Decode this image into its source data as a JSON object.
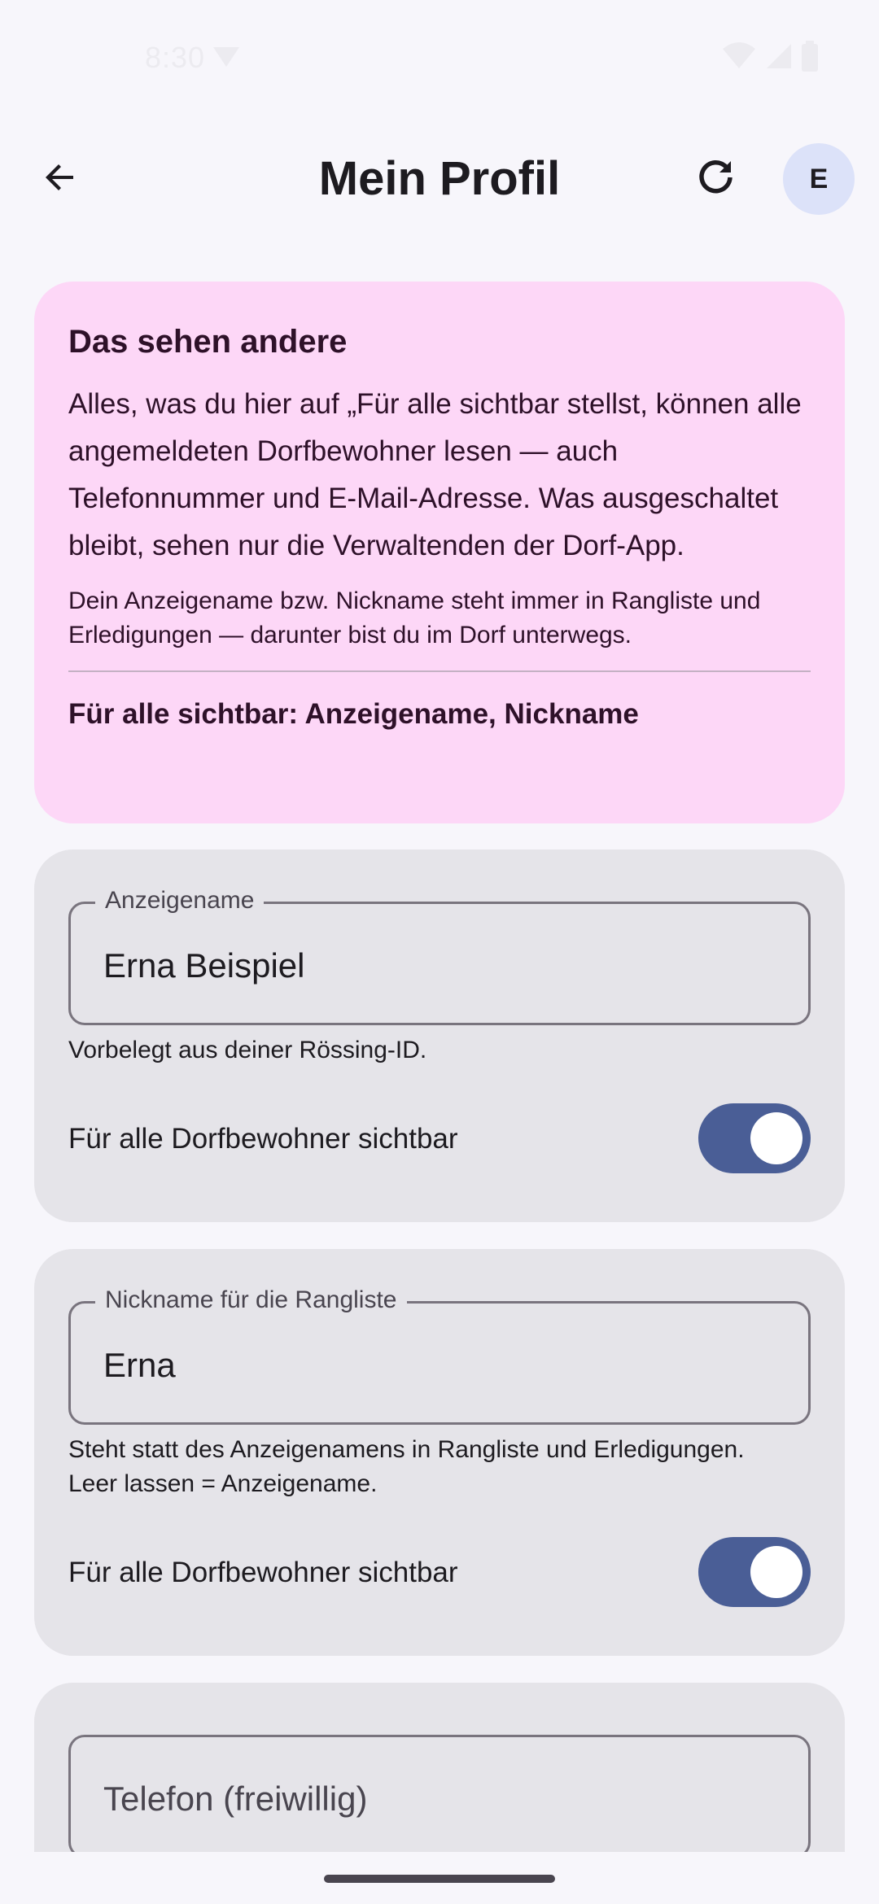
{
  "status_bar": {
    "time": "8:30"
  },
  "header": {
    "title": "Mein Profil",
    "back_icon": "arrow-back-icon",
    "refresh_icon": "refresh-icon",
    "avatar_initial": "E"
  },
  "info_card": {
    "title": "Das sehen andere",
    "body": "Alles, was du hier auf „Für alle sichtbar stellst, können alle angemeldeten Dorfbewohner lesen — auch Telefonnummer und E-Mail-Adresse. Was ausgeschaltet bleibt, sehen nur die Verwaltenden der Dorf-App.",
    "note": "Dein Anzeigename bzw. Nickname steht immer in Rangliste und Erledigungen — darunter bist du im Dorf unterwegs.",
    "summary": "Für alle sichtbar: Anzeigename, Nickname",
    "background": "#fdd7f7"
  },
  "display_name_card": {
    "label": "Anzeigename",
    "value": "Erna Beispiel",
    "helper": "Vorbelegt aus deiner Rössing-ID.",
    "toggle_label": "Für alle Dorfbewohner sichtbar",
    "toggle_on": true
  },
  "nickname_card": {
    "label": "Nickname für die Rangliste",
    "value": "Erna",
    "helper_line1": "Steht statt des Anzeigenamens in Rangliste und Erledigungen.",
    "helper_line2": "Leer lassen = Anzeigename.",
    "toggle_label": "Für alle Dorfbewohner sichtbar",
    "toggle_on": true
  },
  "phone_card": {
    "placeholder": "Telefon (freiwillig)"
  },
  "colors": {
    "switch_track": "#4a5e96",
    "card_background": "#e5e4e9",
    "page_background": "#f7f6fb",
    "avatar_background": "#dce2f9"
  }
}
